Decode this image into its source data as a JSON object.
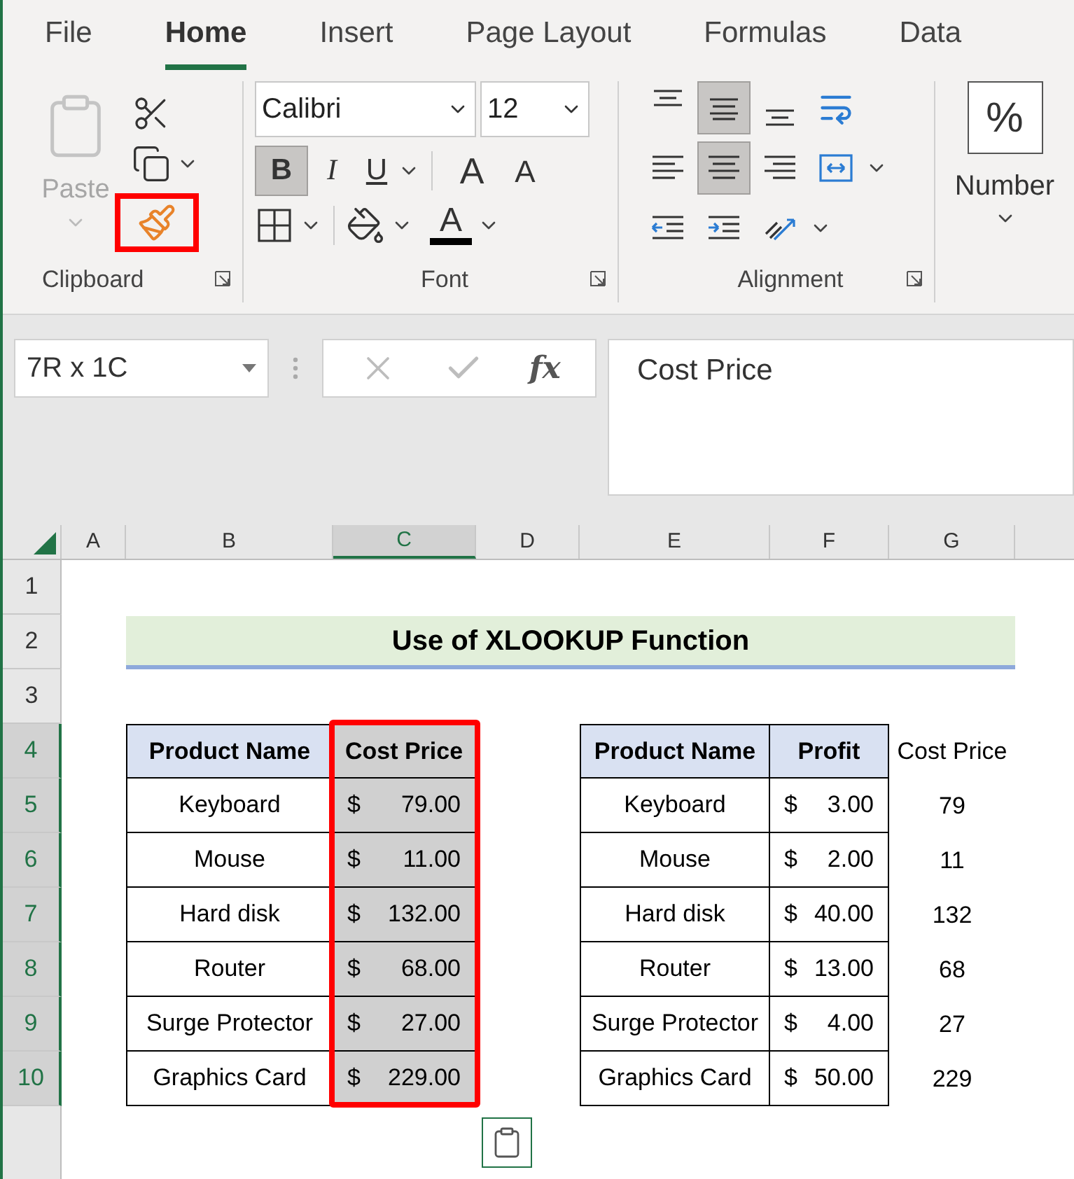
{
  "ribbon_tabs": [
    {
      "label": "File",
      "selected": false
    },
    {
      "label": "Home",
      "selected": true
    },
    {
      "label": "Insert",
      "selected": false
    },
    {
      "label": "Page Layout",
      "selected": false
    },
    {
      "label": "Formulas",
      "selected": false
    },
    {
      "label": "Data",
      "selected": false
    }
  ],
  "clipboard": {
    "paste": {
      "label": "Paste",
      "disabled": true
    },
    "format_painter": {
      "highlighted": true
    },
    "group_label": "Clipboard"
  },
  "font": {
    "font_name": "Calibri",
    "font_size": "12",
    "group_label": "Font",
    "buttons": [
      {
        "kind": "bold",
        "label": "B",
        "selected": true
      },
      {
        "kind": "italic",
        "label": "I",
        "selected": false
      },
      {
        "kind": "underline",
        "label": "U",
        "selected": false
      },
      {
        "kind": "grow",
        "label": "A",
        "selected": false
      },
      {
        "kind": "shrink",
        "label": "A",
        "selected": false
      }
    ],
    "font_color_label": "A"
  },
  "alignment": {
    "group_label": "Alignment",
    "buttons": [
      {
        "kind": "top",
        "selected": false
      },
      {
        "kind": "middle",
        "selected": true
      },
      {
        "kind": "bottom",
        "selected": false
      },
      {
        "kind": "wrap",
        "selected": false
      },
      {
        "kind": "left",
        "selected": false
      },
      {
        "kind": "center",
        "selected": true
      },
      {
        "kind": "right",
        "selected": false
      },
      {
        "kind": "merge",
        "selected": false
      },
      {
        "kind": "outdent",
        "selected": false
      },
      {
        "kind": "indent",
        "selected": false
      },
      {
        "kind": "orientation",
        "selected": false
      }
    ]
  },
  "number": {
    "symbol": "%",
    "label": "Number"
  },
  "formula_bar": {
    "name_box": "7R x 1C",
    "function_label": "fx",
    "content": "Cost Price"
  },
  "columns": [
    {
      "label": "A",
      "selected": false
    },
    {
      "label": "B",
      "selected": false
    },
    {
      "label": "C",
      "selected": true
    },
    {
      "label": "D",
      "selected": false
    },
    {
      "label": "E",
      "selected": false
    },
    {
      "label": "F",
      "selected": false
    },
    {
      "label": "G",
      "selected": false
    }
  ],
  "rows": [
    {
      "label": "1",
      "selected": false
    },
    {
      "label": "2",
      "selected": false
    },
    {
      "label": "3",
      "selected": false
    },
    {
      "label": "4",
      "selected": true
    },
    {
      "label": "5",
      "selected": true
    },
    {
      "label": "6",
      "selected": true
    },
    {
      "label": "7",
      "selected": true
    },
    {
      "label": "8",
      "selected": true
    },
    {
      "label": "9",
      "selected": true
    },
    {
      "label": "10",
      "selected": true
    }
  ],
  "sheet_title": "Use of XLOOKUP Function",
  "left_table": {
    "columns": [
      {
        "label": "Product Name",
        "selected": false
      },
      {
        "label": "Cost Price",
        "selected": true
      }
    ],
    "rows": [
      {
        "product": "Keyboard",
        "currency": "$",
        "amount": "79.00"
      },
      {
        "product": "Mouse",
        "currency": "$",
        "amount": "11.00"
      },
      {
        "product": "Hard disk",
        "currency": "$",
        "amount": "132.00"
      },
      {
        "product": "Router",
        "currency": "$",
        "amount": "68.00"
      },
      {
        "product": "Surge Protector",
        "currency": "$",
        "amount": "27.00"
      },
      {
        "product": "Graphics Card",
        "currency": "$",
        "amount": "229.00"
      }
    ]
  },
  "right_table": {
    "columns": [
      "Product Name",
      "Profit"
    ],
    "rows": [
      {
        "product": "Keyboard",
        "currency": "$",
        "amount": "3.00"
      },
      {
        "product": "Mouse",
        "currency": "$",
        "amount": "2.00"
      },
      {
        "product": "Hard disk",
        "currency": "$",
        "amount": "40.00"
      },
      {
        "product": "Router",
        "currency": "$",
        "amount": "13.00"
      },
      {
        "product": "Surge Protector",
        "currency": "$",
        "amount": "4.00"
      },
      {
        "product": "Graphics Card",
        "currency": "$",
        "amount": "50.00"
      }
    ]
  },
  "lookup_column": {
    "header": "Cost Price",
    "values": [
      "79",
      "11",
      "132",
      "68",
      "27",
      "229"
    ]
  }
}
